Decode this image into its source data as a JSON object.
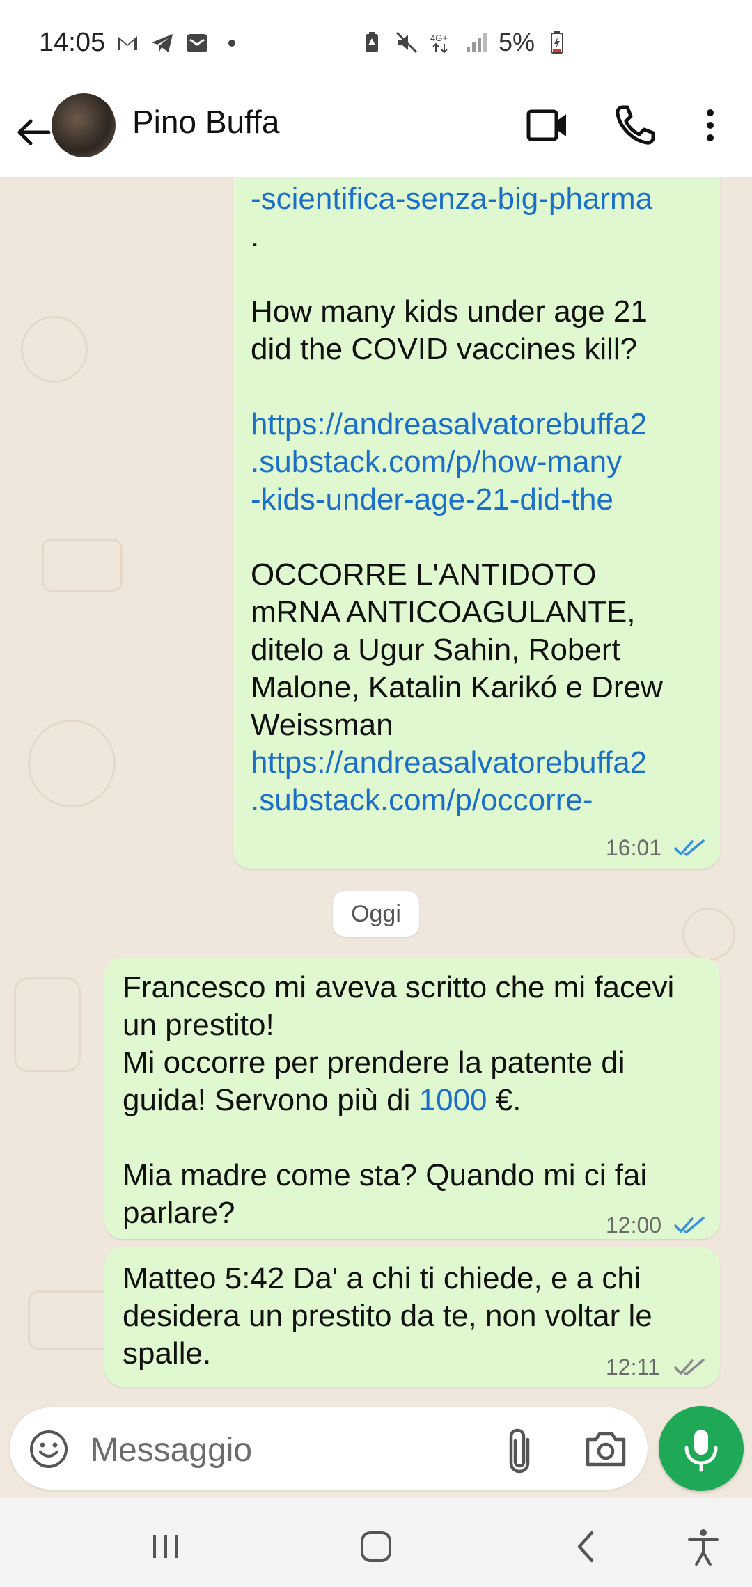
{
  "status_bar": {
    "time": "14:05",
    "battery": "5%"
  },
  "header": {
    "contact_name": "Pino Buffa"
  },
  "messages": [
    {
      "id": "m1",
      "parts": [
        {
          "kind": "link",
          "text": "-scientifica-senza-big-pharma"
        },
        {
          "kind": "text",
          "text": "."
        },
        {
          "kind": "text",
          "text": "How many kids under age 21"
        },
        {
          "kind": "text",
          "text": "did the COVID vaccines kill?"
        },
        {
          "kind": "link",
          "text": "https://andreasalvatorebuffa2"
        },
        {
          "kind": "link",
          "text": ".substack.com/p/how-many"
        },
        {
          "kind": "link",
          "text": "-kids-under-age-21-did-the"
        },
        {
          "kind": "text",
          "text": "OCCORRE L'ANTIDOTO"
        },
        {
          "kind": "text",
          "text": "mRNA ANTICOAGULANTE,"
        },
        {
          "kind": "text",
          "text": "ditelo a Ugur Sahin, Robert"
        },
        {
          "kind": "text",
          "text": "Malone, Katalin Karikó e Drew"
        },
        {
          "kind": "text",
          "text": "Weissman"
        },
        {
          "kind": "link",
          "text": "https://andreasalvatorebuffa2"
        },
        {
          "kind": "link",
          "text": ".substack.com/p/occorre-"
        }
      ],
      "time": "16:01",
      "ticks": "read"
    },
    {
      "id": "m2",
      "lines": [
        "Francesco mi aveva scritto che mi facevi",
        "un prestito!",
        "Mi occorre per prendere la patente di",
        "guida! Servono più di ",
        "1000",
        " €.",
        "Mia madre come sta? Quando mi ci fai",
        "parlare?"
      ],
      "time": "12:00",
      "ticks": "read"
    },
    {
      "id": "m3",
      "lines": [
        "Matteo 5:42  Da' a chi ti chiede, e a chi",
        "desidera un prestito da te, non voltar le",
        "spalle."
      ],
      "time": "12:11",
      "ticks": "delivered"
    }
  ],
  "date_divider": "Oggi",
  "composer": {
    "placeholder": "Messaggio"
  },
  "colors": {
    "bubble": "#dff8cf",
    "link": "#1b6fc8",
    "read_ticks": "#3a8fe0",
    "mic": "#1fa855"
  }
}
